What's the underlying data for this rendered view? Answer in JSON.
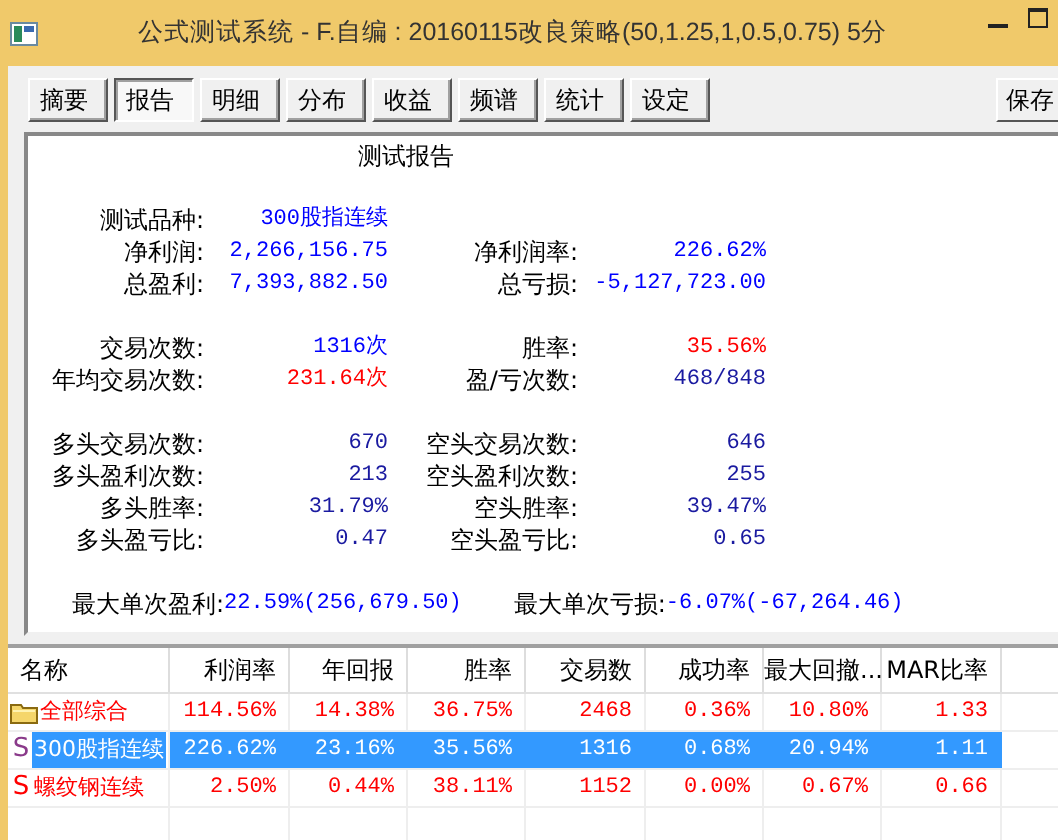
{
  "window": {
    "title": "公式测试系统 - F.自编 : 20160115改良策略(50,1.25,1,0.5,0.75) 5分"
  },
  "tabs": [
    {
      "label": "摘要",
      "selected": false
    },
    {
      "label": "报告",
      "selected": true
    },
    {
      "label": "明细",
      "selected": false
    },
    {
      "label": "分布",
      "selected": false
    },
    {
      "label": "收益",
      "selected": false
    },
    {
      "label": "频谱",
      "selected": false
    },
    {
      "label": "统计",
      "selected": false
    },
    {
      "label": "设定",
      "selected": false
    }
  ],
  "save_button": "保存",
  "report": {
    "title": "测试报告",
    "sections": [
      {
        "rows": [
          {
            "kind": "pair",
            "left": {
              "label": "测试品种:",
              "value": "300股指连续",
              "color": "#0000ff"
            }
          },
          {
            "kind": "pair",
            "left": {
              "label": "净利润:",
              "value": "2,266,156.75",
              "color": "#0000ff"
            },
            "right": {
              "label": "净利润率:",
              "value": "226.62%",
              "color": "#0000ff"
            }
          },
          {
            "kind": "pair",
            "left": {
              "label": "总盈利:",
              "value": "7,393,882.50",
              "color": "#0000ff"
            },
            "right": {
              "label": "总亏损:",
              "value": "-5,127,723.00",
              "color": "#0000ff"
            }
          }
        ]
      },
      {
        "rows": [
          {
            "kind": "pair",
            "left": {
              "label": "交易次数:",
              "value": "1316次",
              "color": "#0000ff"
            },
            "right": {
              "label": "胜率:",
              "value": "35.56%",
              "color": "#ff0000"
            }
          },
          {
            "kind": "pair",
            "left": {
              "label": "年均交易次数:",
              "value": "231.64次",
              "color": "#ff0000"
            },
            "right": {
              "label": "盈/亏次数:",
              "value": "468/848",
              "color": "#1a1aa0"
            }
          }
        ]
      },
      {
        "rows": [
          {
            "kind": "pair",
            "left": {
              "label": "多头交易次数:",
              "value": "670",
              "color": "#1a1aa0"
            },
            "right": {
              "label": "空头交易次数:",
              "value": "646",
              "color": "#1a1aa0"
            }
          },
          {
            "kind": "pair",
            "left": {
              "label": "多头盈利次数:",
              "value": "213",
              "color": "#1a1aa0"
            },
            "right": {
              "label": "空头盈利次数:",
              "value": "255",
              "color": "#1a1aa0"
            }
          },
          {
            "kind": "pair",
            "left": {
              "label": "多头胜率:",
              "value": "31.79%",
              "color": "#1a1aa0"
            },
            "right": {
              "label": "空头胜率:",
              "value": "39.47%",
              "color": "#1a1aa0"
            }
          },
          {
            "kind": "pair",
            "left": {
              "label": "多头盈亏比:",
              "value": "0.47",
              "color": "#1a1aa0"
            },
            "right": {
              "label": "空头盈亏比:",
              "value": "0.65",
              "color": "#1a1aa0"
            }
          }
        ]
      },
      {
        "rows": [
          {
            "kind": "inline",
            "left": {
              "label": "最大单次盈利:",
              "value": "22.59%(256,679.50)",
              "color": "#0000ff"
            },
            "right": {
              "label": "最大单次亏损:",
              "value": "-6.07%(-67,264.46)",
              "color": "#0000ff"
            }
          }
        ]
      }
    ]
  },
  "table": {
    "columns": [
      "名称",
      "利润率",
      "年回报",
      "胜率",
      "交易数",
      "成功率",
      "最大回撤...",
      "MAR比率"
    ],
    "rows": [
      {
        "kind": "group",
        "selected": false,
        "cells": [
          "全部综合",
          "114.56%",
          "14.38%",
          "36.75%",
          "2468",
          "0.36%",
          "10.80%",
          "1.33"
        ]
      },
      {
        "kind": "strategy",
        "marker": "S",
        "selected": true,
        "cells": [
          "300股指连续",
          "226.62%",
          "23.16%",
          "35.56%",
          "1316",
          "0.68%",
          "20.94%",
          "1.11"
        ]
      },
      {
        "kind": "strategy",
        "marker": "S",
        "selected": false,
        "cells": [
          "螺纹钢连续",
          "2.50%",
          "0.44%",
          "38.11%",
          "1152",
          "0.00%",
          "0.67%",
          "0.66"
        ]
      }
    ]
  }
}
